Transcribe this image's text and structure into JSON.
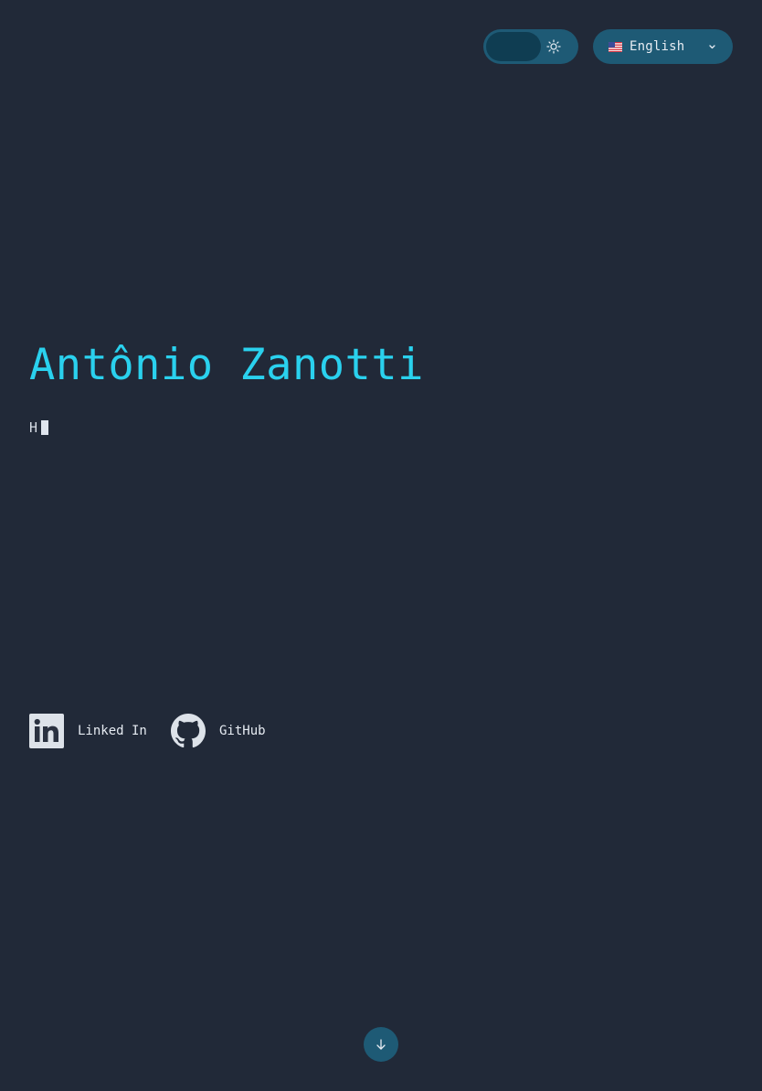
{
  "header": {
    "theme_toggle": {
      "mode": "dark",
      "icon": "sun-icon"
    },
    "language": {
      "selected": "English",
      "flag": "us-flag-icon"
    }
  },
  "hero": {
    "name": "Antônio Zanotti",
    "typing_text": "H"
  },
  "social": [
    {
      "label": "Linked In",
      "icon": "linkedin-icon"
    },
    {
      "label": "GitHub",
      "icon": "github-icon"
    }
  ],
  "scroll": {
    "icon": "arrow-down-icon"
  },
  "colors": {
    "background": "#212938",
    "accent": "#2ad1ee",
    "control": "#1e5a75",
    "control_dark": "#0f3d52"
  }
}
